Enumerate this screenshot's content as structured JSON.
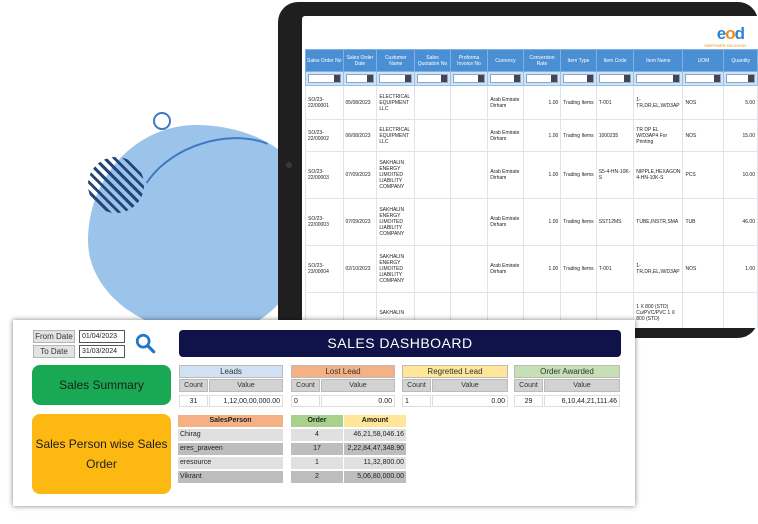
{
  "tablet": {
    "logo": {
      "part1": "e",
      "part2": "o",
      "part3": "d",
      "tagline": "EMPOWER DECISION"
    },
    "columns": [
      "Sales Order No",
      "Sales Order Date",
      "Customer Name",
      "Sales Quotation No",
      "Proforma Invoice No",
      "Currency",
      "Conversion Rate",
      "Item Type",
      "Item Code",
      "Item Name",
      "UOM",
      "Quantity"
    ],
    "rows": [
      [
        "SO/23-22/00001",
        "05/08/2023",
        "ELECTRICAL EQUIPMENT LLC",
        "",
        "",
        "Arab Emirate Dirham",
        "1.00",
        "Trading Items",
        "T-001",
        "1-TR,DR,EL,W/D3AP",
        "NOS",
        "5.00"
      ],
      [
        "SO/23-22/00002",
        "06/08/2023",
        "ELECTRICAL EQUIPMENT LLC",
        "",
        "",
        "Arab Emirate Dirham",
        "1.00",
        "Trading Items",
        "1000235",
        "TR DP EL W/D3AP4 For Printing",
        "NOS",
        "15.00"
      ],
      [
        "SO/23-22/00003",
        "07/09/2023",
        "SAKHALIN ENERGY LIMOITED LIABILITY COMPANY",
        "",
        "",
        "Arab Emirate Dirham",
        "1.00",
        "Trading Items",
        "S5-4-HN-10K-S",
        "NIPPLE,HEXAGON 4-HN-10K-S",
        "PCS",
        "10.00"
      ],
      [
        "SO/23-22/00003",
        "07/09/2023",
        "SAKHALIN ENERGY LIMOITED LIABILITY COMPANY",
        "",
        "",
        "Arab Emirate Dirham",
        "1.00",
        "Trading Items",
        "SST12MS",
        "TUBE,INSTR,SMA",
        "TUB",
        "46.00"
      ],
      [
        "SO/23-23/00004",
        "02/10/2023",
        "SAKHALIN ENERGY LIMOITED LIABILITY COMPANY",
        "",
        "",
        "Arab Emirate Dirham",
        "1.00",
        "Trading Items",
        "T-001",
        "1-TR,DR,EL,W/D3AP",
        "NOS",
        "1.00"
      ],
      [
        "",
        "",
        "SAKHALIN",
        "",
        "",
        "",
        "",
        "",
        "",
        "1 X 800 (STD) Cu/PVC/PVC 1 X 800 (STD)",
        "",
        ""
      ]
    ]
  },
  "dashboard": {
    "title": "SALES DASHBOARD",
    "from_date_label": "From Date",
    "from_date": "01/04/2023",
    "to_date_label": "To Date",
    "to_date": "31/03/2024",
    "sales_summary": "Sales Summary",
    "sales_person_wise": "Sales Person wise Sales Order",
    "metrics": [
      {
        "label": "Leads",
        "color": "#cfe1f3",
        "count_label": "Count",
        "value_label": "Value",
        "count": "31",
        "value": "1,12,00,00,000.00"
      },
      {
        "label": "Lost Lead",
        "color": "#f4b183",
        "count_label": "Count",
        "value_label": "Value",
        "count": "0",
        "value": "0.00"
      },
      {
        "label": "Regretted Lead",
        "color": "#ffe699",
        "count_label": "Count",
        "value_label": "Value",
        "count": "1",
        "value": "0.00"
      },
      {
        "label": "Order Awarded",
        "color": "#c5e0b4",
        "count_label": "Count",
        "value_label": "Value",
        "count": "29",
        "value": "6,10,44,21,111.46"
      }
    ],
    "salesperson_table": {
      "headers": {
        "name": "SalesPerson",
        "order": "Order",
        "amount": "Amount"
      },
      "header_colors": {
        "name": "#f4b183",
        "order": "#a9d18e",
        "amount": "#ffe699"
      },
      "rows": [
        {
          "name": "Chirag",
          "order": "4",
          "amount": "46,21,58,046.16"
        },
        {
          "name": "eres_praveen",
          "order": "17",
          "amount": "2,22,84,47,348.90"
        },
        {
          "name": "eresource",
          "order": "1",
          "amount": "11,32,800.00"
        },
        {
          "name": "Vikrant",
          "order": "2",
          "amount": "5,06,80,000.00"
        }
      ]
    }
  }
}
